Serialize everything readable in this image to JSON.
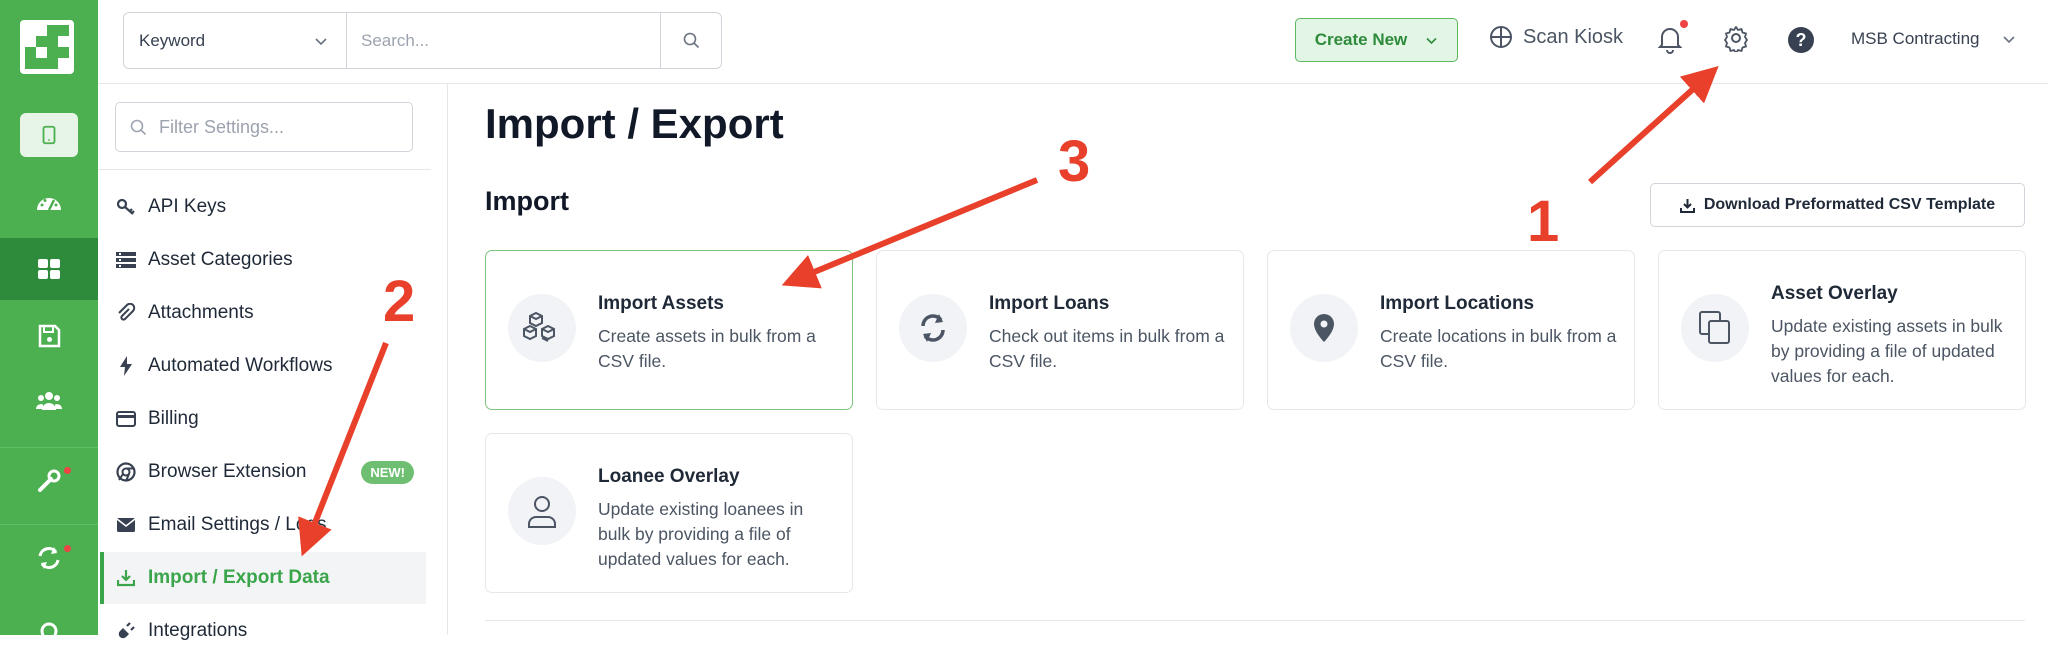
{
  "rail": {
    "items": [
      "logo-icon",
      "tablet-icon",
      "dashboard-icon",
      "grid-icon",
      "save-icon",
      "users-icon",
      "tools-icon",
      "sync-icon",
      "map-pin-icon"
    ],
    "accent": "#4caf50",
    "active": "#2e8b3c"
  },
  "topbar": {
    "keyword_select": "Keyword",
    "search_placeholder": "Search...",
    "create_new": "Create New",
    "scan_kiosk": "Scan Kiosk",
    "help": "?",
    "org": "MSB Contracting"
  },
  "settings": {
    "filter_placeholder": "Filter Settings...",
    "items": [
      {
        "label": "API Keys",
        "icon": "key-icon"
      },
      {
        "label": "Asset Categories",
        "icon": "list-icon"
      },
      {
        "label": "Attachments",
        "icon": "paperclip-icon"
      },
      {
        "label": "Automated Workflows",
        "icon": "bolt-icon"
      },
      {
        "label": "Billing",
        "icon": "credit-card-icon"
      },
      {
        "label": "Browser Extension",
        "icon": "chrome-icon",
        "badge": "NEW!"
      },
      {
        "label": "Email Settings / Logs",
        "icon": "envelope-icon"
      },
      {
        "label": "Import / Export Data",
        "icon": "download-icon",
        "active": true
      },
      {
        "label": "Integrations",
        "icon": "plug-icon"
      }
    ]
  },
  "main": {
    "title": "Import / Export",
    "section": "Import",
    "download_button": "Download Preformatted CSV Template",
    "cards": [
      {
        "title": "Import Assets",
        "desc": "Create assets in bulk from a CSV file.",
        "icon": "cubes-icon"
      },
      {
        "title": "Import Loans",
        "desc": "Check out items in bulk from a CSV file.",
        "icon": "sync-icon"
      },
      {
        "title": "Import Locations",
        "desc": "Create locations in bulk from a CSV file.",
        "icon": "map-pin-icon"
      },
      {
        "title": "Asset Overlay",
        "desc": "Update existing assets in bulk by providing a file of updated values for each.",
        "icon": "copy-icon"
      },
      {
        "title": "Loanee Overlay",
        "desc": "Update existing loanees in bulk by providing a file of updated values for each.",
        "icon": "user-icon"
      }
    ]
  },
  "annotations": {
    "one": "1",
    "two": "2",
    "three": "3",
    "color": "#e8402a"
  }
}
